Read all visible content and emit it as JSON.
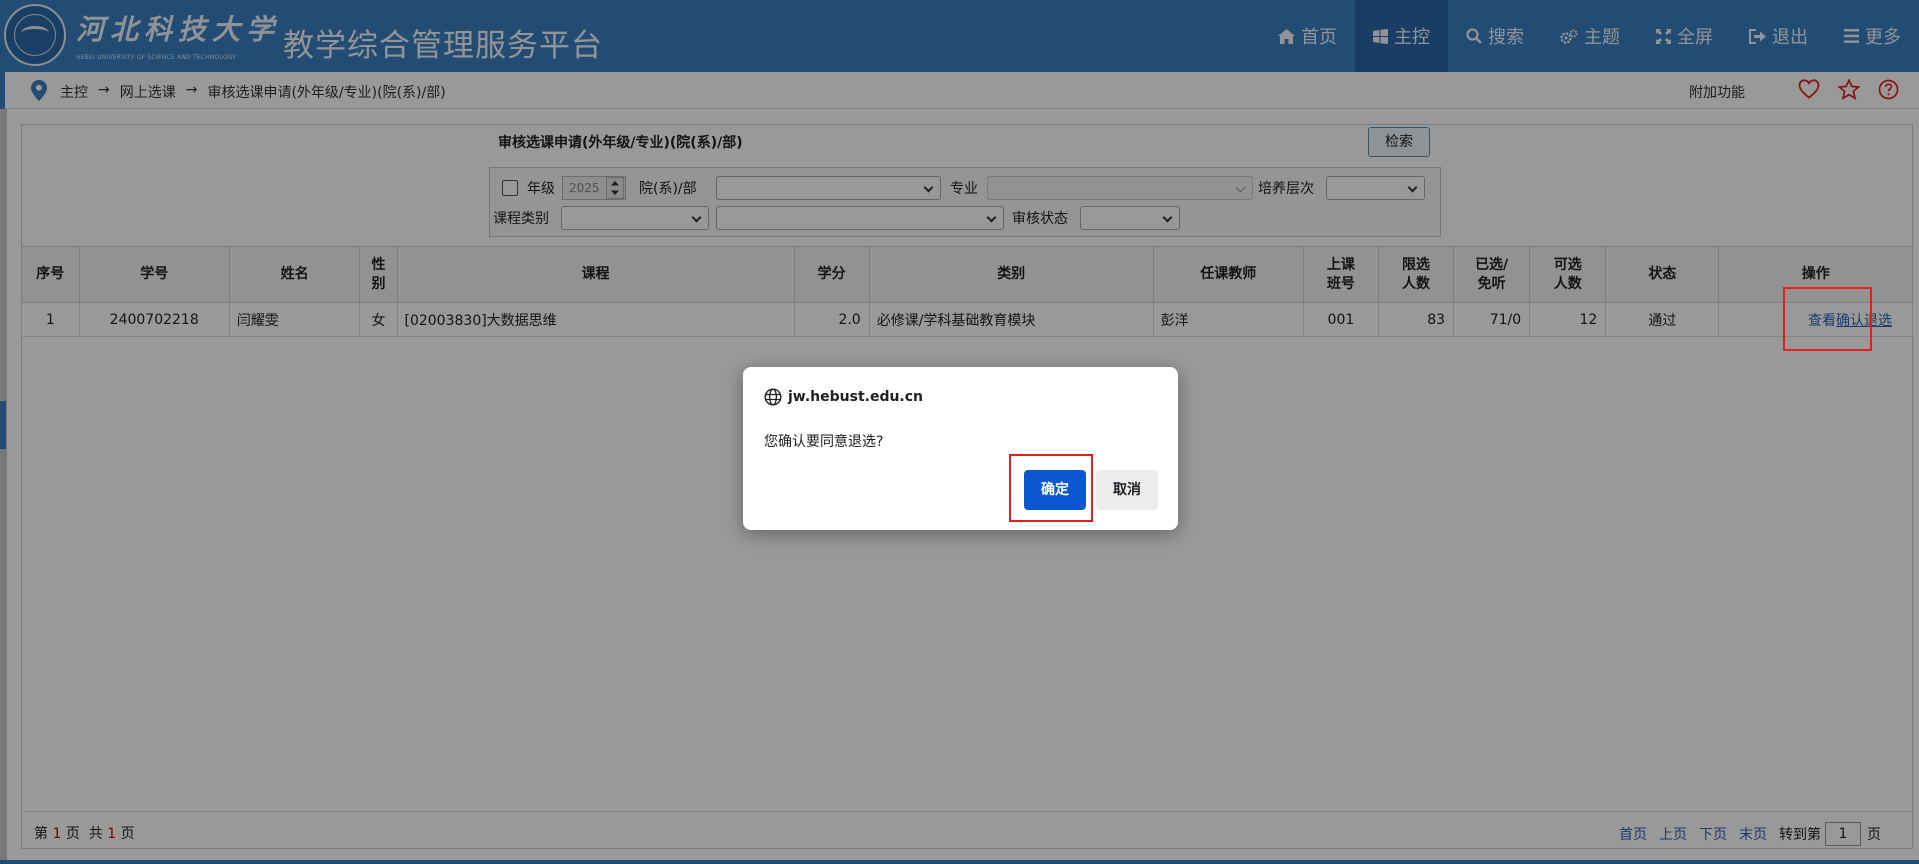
{
  "header": {
    "school_name_cn": "河北科技大学",
    "school_name_en": "HEBEI UNIVERSITY OF SCIENCE AND TECHNOLOGY",
    "platform_title": "教学综合管理服务平台",
    "nav": [
      {
        "label": "首页",
        "icon": "home-icon"
      },
      {
        "label": "主控",
        "icon": "windows-icon"
      },
      {
        "label": "搜索",
        "icon": "search-icon"
      },
      {
        "label": "主题",
        "icon": "cogs-icon"
      },
      {
        "label": "全屏",
        "icon": "expand-icon"
      },
      {
        "label": "退出",
        "icon": "sign-out-icon"
      },
      {
        "label": "更多",
        "icon": "menu-icon"
      }
    ],
    "active_nav": "主控"
  },
  "breadcrumb": {
    "items": [
      "主控",
      "网上选课",
      "审核选课申请(外年级/专业)(院(系)/部)"
    ],
    "separator": "→",
    "extra_label": "附加功能"
  },
  "search": {
    "title": "审核选课申请(外年级/专业)(院(系)/部)",
    "search_button": "检索",
    "labels": {
      "grade": "年级",
      "dept": "院(系)/部",
      "major": "专业",
      "level": "培养层次",
      "course_type": "课程类别",
      "review_status": "审核状态"
    },
    "grade_value": "2025"
  },
  "table": {
    "headers": [
      "序号",
      "学号",
      "姓名",
      "性\n别",
      "课程",
      "学分",
      "类别",
      "任课教师",
      "上课\n班号",
      "限选\n人数",
      "已选/\n免听",
      "可选\n人数",
      "状态",
      "操作"
    ],
    "rows": [
      {
        "index": "1",
        "student_id": "2400702218",
        "name": "闫耀雯",
        "gender": "女",
        "course": "[02003830]大数据思维",
        "credit": "2.0",
        "category": "必修课/学科基础教育模块",
        "teacher": "彭洋",
        "class_no": "001",
        "limit": "83",
        "selected": "71/0",
        "available": "12",
        "status": "通过",
        "actions": [
          "查看",
          "确认退选"
        ]
      }
    ]
  },
  "pager": {
    "page_prefix": "第",
    "current_page": "1",
    "page_suffix": "页",
    "total_prefix": "共",
    "total_pages": "1",
    "total_suffix": "页",
    "first": "首页",
    "prev": "上页",
    "next": "下页",
    "last": "末页",
    "goto_prefix": "转到第",
    "goto_value": "1",
    "goto_suffix": "页"
  },
  "dialog": {
    "host": "jw.hebust.edu.cn",
    "message": "您确认要同意退选?",
    "ok": "确定",
    "cancel": "取消"
  },
  "colors": {
    "header_bg": "#3a7fc2",
    "header_active": "#2a67a7",
    "ok_button": "#0b57d0",
    "highlight": "#e4201c",
    "page_number": "#d40000"
  }
}
